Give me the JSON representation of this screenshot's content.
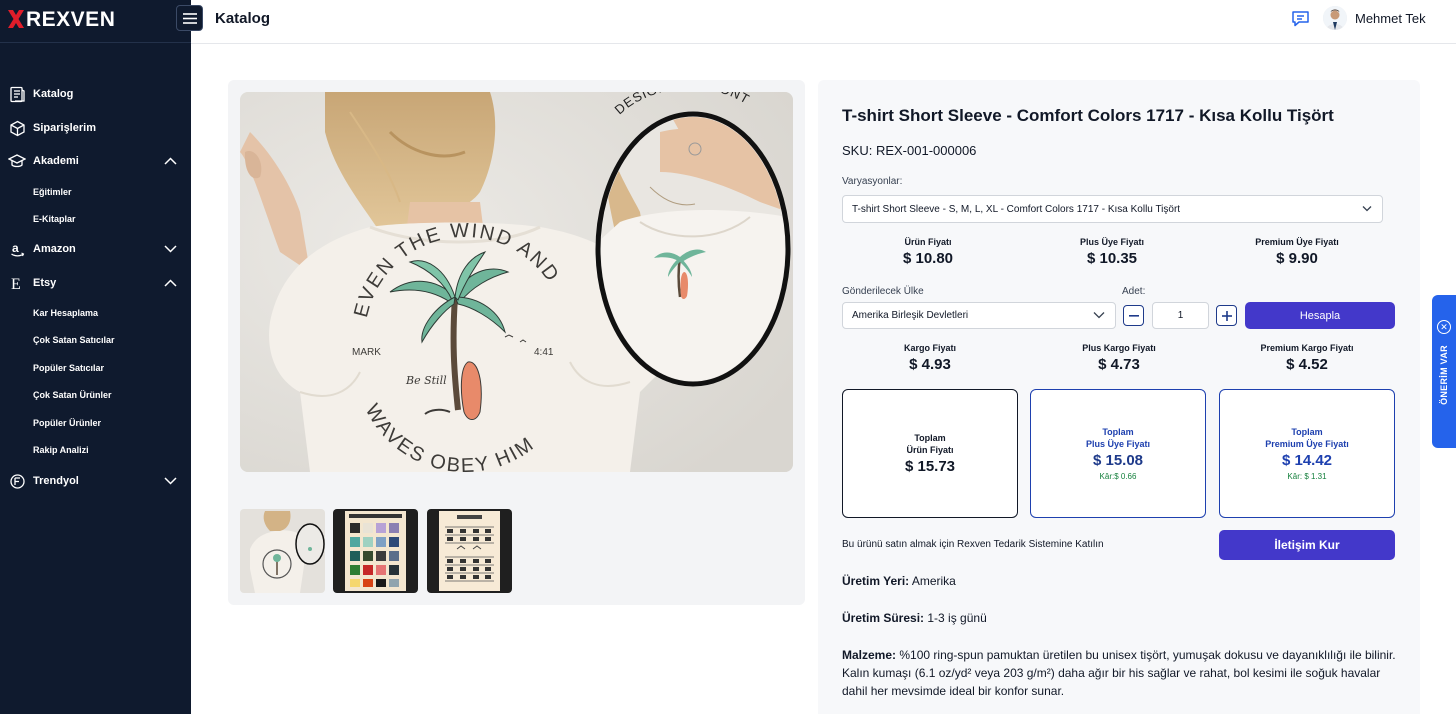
{
  "app": {
    "logo_text": "REXVEN",
    "page_title": "Katalog",
    "user_name": "Mehmet Tek"
  },
  "sidebar": {
    "items": [
      {
        "label": "Katalog",
        "icon": "catalog-icon"
      },
      {
        "label": "Siparişlerim",
        "icon": "box-icon"
      },
      {
        "label": "Akademi",
        "icon": "graduation-cap-icon",
        "expanded": true
      },
      {
        "label": "Eğitimler"
      },
      {
        "label": "E-Kitaplar"
      },
      {
        "label": "Amazon",
        "icon": "amazon-icon",
        "expanded": false
      },
      {
        "label": "Etsy",
        "icon": "etsy-icon",
        "expanded": true
      },
      {
        "label": "Kar Hesaplama"
      },
      {
        "label": "Çok Satan Satıcılar"
      },
      {
        "label": "Popüler Satıcılar"
      },
      {
        "label": "Çok Satan Ürünler"
      },
      {
        "label": "Popüler Ürünler"
      },
      {
        "label": "Rakip Analizi"
      },
      {
        "label": "Trendyol",
        "icon": "trendyol-icon",
        "expanded": false
      }
    ]
  },
  "product": {
    "title": "T-shirt Short Sleeve - Comfort Colors 1717 - Kısa Kollu Tişört",
    "sku": "SKU: REX-001-000006",
    "variations_label": "Varyasyonlar:",
    "variation_selected": "T-shirt Short Sleeve - S, M, L, XL - Comfort Colors 1717 - Kısa Kollu Tişört",
    "shirt_print": {
      "top_text": "EVEN THE WIND AND",
      "bottom_text": "WAVES OBEY HIM",
      "left_text": "MARK",
      "right_text": "4:41",
      "script_text": "Be Still",
      "design_on_front": "DESIGN ON FRONT"
    },
    "prices": [
      {
        "label": "Ürün Fiyatı",
        "value": "$ 10.80"
      },
      {
        "label": "Plus Üye Fiyatı",
        "value": "$ 10.35"
      },
      {
        "label": "Premium Üye Fiyatı",
        "value": "$ 9.90"
      }
    ],
    "country_label": "Gönderilecek Ülke",
    "country_selected": "Amerika Birleşik Devletleri",
    "qty_label": "Adet:",
    "qty_value": "1",
    "calculate_label": "Hesapla",
    "shipping": [
      {
        "label": "Kargo Fiyatı",
        "value": "$ 4.93"
      },
      {
        "label": "Plus Kargo Fiyatı",
        "value": "$ 4.73"
      },
      {
        "label": "Premium Kargo Fiyatı",
        "value": "$ 4.52"
      }
    ],
    "totals": [
      {
        "label_1": "Toplam",
        "label_2": "Ürün Fiyatı",
        "value": "$ 15.73",
        "kar": ""
      },
      {
        "label_1": "Toplam",
        "label_2": "Plus Üye Fiyatı",
        "value": "$ 15.08",
        "kar": "Kâr:$ 0.66"
      },
      {
        "label_1": "Toplam",
        "label_2": "Premium Üye Fiyatı",
        "value": "$ 14.42",
        "kar": "Kâr: $ 1.31"
      }
    ],
    "join_text": "Bu ürünü satın almak için Rexven Tedarik Sistemine Katılın",
    "contact_label": "İletişim Kur",
    "origin_label": "Üretim Yeri:",
    "origin_value": "Amerika",
    "duration_label": "Üretim Süresi:",
    "duration_value": "1-3 iş günü",
    "material_label": "Malzeme:",
    "material_value": "%100 ring-spun pamuktan üretilen bu unisex tişört, yumuşak dokusu ve dayanıklılığı ile bilinir. Kalın kumaşı (6.1 oz/yd² veya 203 g/m²) daha ağır bir his sağlar ve rahat, bol kesimi ile soğuk havalar dahil her mevsimde ideal bir konfor sunar."
  },
  "suggest": {
    "label": "ÖNERİM VAR"
  },
  "colors": {
    "sidebar_bg": "#0f1a2e",
    "primary": "#4338ca",
    "accent_blue": "#1e40af",
    "profit_green": "#15803d"
  }
}
